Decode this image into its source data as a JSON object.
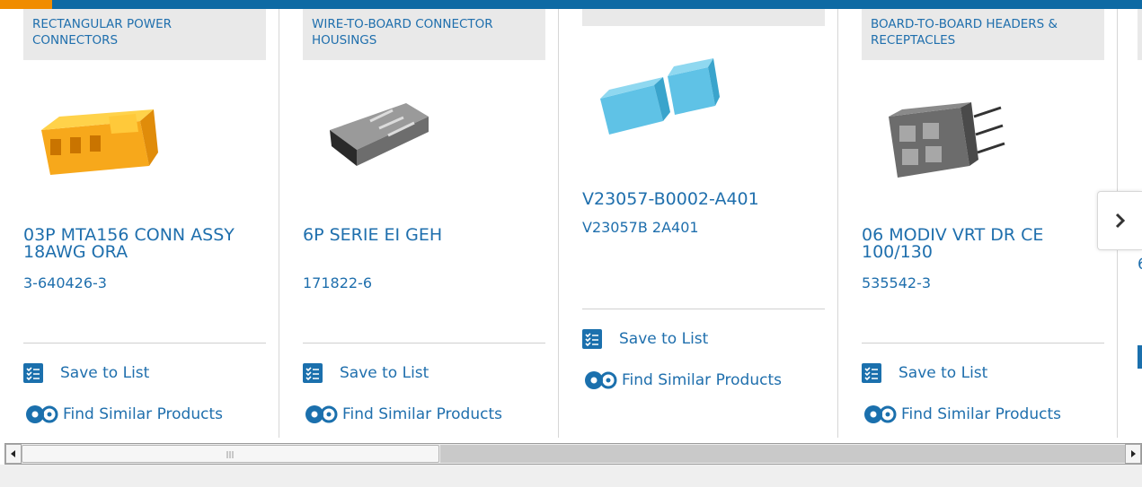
{
  "products": [
    {
      "category": "RECTANGULAR POWER CONNECTORS",
      "title": "03P MTA156 CONN ASSY 18AWG ORA",
      "part_number": "3-640426-3",
      "image_icon": "orange-connector-image",
      "save_label": "Save to List",
      "similar_label": "Find Similar Products"
    },
    {
      "category": "WIRE-TO-BOARD CONNECTOR HOUSINGS",
      "title": "6P SERIE EI GEH",
      "part_number": "171822-6",
      "image_icon": "grey-housing-image",
      "save_label": "Save to List",
      "similar_label": "Find Similar Products"
    },
    {
      "category": "",
      "title": "V23057-B0002-A401",
      "part_number": "V23057B 2A401",
      "image_icon": "blue-relay-image",
      "save_label": "Save to List",
      "similar_label": "Find Similar Products"
    },
    {
      "category": "BOARD-TO-BOARD HEADERS & RECEPTACLES",
      "title": "06 MODIV VRT DR CE 100/130",
      "part_number": "535542-3",
      "image_icon": "header-receptacle-image",
      "save_label": "Save to List",
      "similar_label": "Find Similar Products"
    }
  ],
  "partial_card_text": "6",
  "nav": {
    "next_icon": "chevron-right-icon"
  },
  "colors": {
    "link": "#1f6fad",
    "accent_orange": "#f08c00",
    "top_blue": "#0e6aa4"
  }
}
